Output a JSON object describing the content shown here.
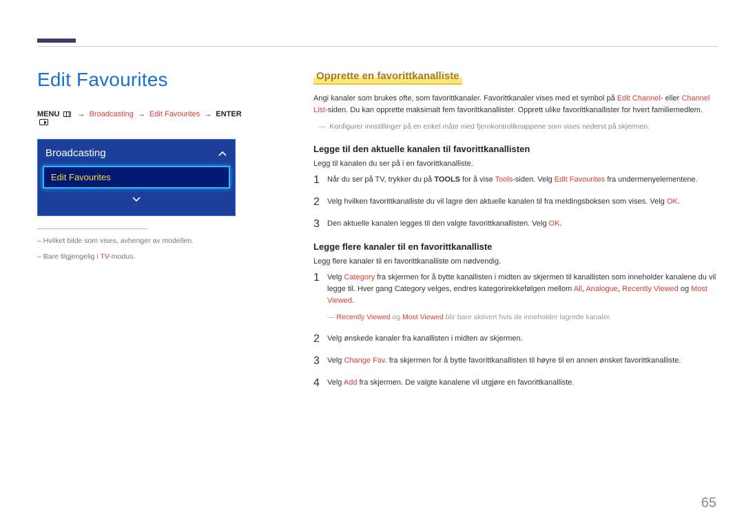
{
  "left": {
    "page_title": "Edit Favourites",
    "menu_path": {
      "menu": "MENU",
      "p1": "Broadcasting",
      "p2": "Edit Favourites",
      "enter": "ENTER"
    },
    "bc_panel": {
      "header": "Broadcasting",
      "item": "Edit Favourites"
    },
    "notes": {
      "n1": "Hvilket bilde som vises, avhenger av modellen.",
      "n2_pre": "Bare tilgjengelig i ",
      "n2_hl": "TV",
      "n2_post": "-modus."
    }
  },
  "right": {
    "section_title": "Opprette en favorittkanalliste",
    "intro": {
      "t1": "Angi kanaler som brukes ofte, som favorittkanaler. Favorittkanaler vises med et symbol på ",
      "hl1": "Edit Channel",
      "t2": "- eller ",
      "hl2": "Channel List",
      "t3": "-siden. Du kan opprette maksimalt fem favorittkanallister. Opprett ulike favorittkanallister for hvert familiemedlem."
    },
    "intro_note": "Konfigurer innstillinger på en enkel måte med fjernkontrollknappene som vises nederst på skjermen.",
    "sub1": {
      "heading": "Legge til den aktuelle kanalen til favorittkanallisten",
      "lead": "Legg til kanalen du ser på i en favorittkanalliste.",
      "steps": [
        {
          "num": "1",
          "parts": [
            {
              "t": "Når du ser på TV, trykker du på "
            },
            {
              "b": "TOOLS"
            },
            {
              "t": " for å vise "
            },
            {
              "hl": "Tools"
            },
            {
              "t": "-siden. Velg "
            },
            {
              "hl": "Edit Favourites"
            },
            {
              "t": " fra undermenyelementene."
            }
          ]
        },
        {
          "num": "2",
          "parts": [
            {
              "t": "Velg hvilken favorittkanalliste du vil lagre den aktuelle kanalen til fra meldingsboksen som vises. Velg "
            },
            {
              "hl": "OK"
            },
            {
              "t": "."
            }
          ]
        },
        {
          "num": "3",
          "parts": [
            {
              "t": "Den aktuelle kanalen legges til den valgte favorittkanallisten. Velg "
            },
            {
              "hl": "OK"
            },
            {
              "t": "."
            }
          ]
        }
      ]
    },
    "sub2": {
      "heading": "Legge flere kanaler til en favorittkanalliste",
      "lead": "Legg flere kanaler til en favorittkanalliste om nødvendig.",
      "steps": [
        {
          "num": "1",
          "parts": [
            {
              "t": "Velg "
            },
            {
              "hl": "Category"
            },
            {
              "t": " fra skjermen for å bytte kanallisten i midten av skjermen til kanallisten som inneholder kanalene du vil legge til. Hver gang Category velges, endres kategorirekkefølgen mellom "
            },
            {
              "hl": "All"
            },
            {
              "t": ", "
            },
            {
              "hl": "Analogue"
            },
            {
              "t": ", "
            },
            {
              "hl": "Recently Viewed"
            },
            {
              "t": " og "
            },
            {
              "hl": "Most Viewed"
            },
            {
              "t": "."
            }
          ],
          "note": [
            {
              "hl": "Recently Viewed"
            },
            {
              "t": " og "
            },
            {
              "hl": "Most Viewed"
            },
            {
              "t": " blir bare aktivert hvis de inneholder lagrede kanaler."
            }
          ]
        },
        {
          "num": "2",
          "parts": [
            {
              "t": "Velg ønskede kanaler fra kanallisten i midten av skjermen."
            }
          ]
        },
        {
          "num": "3",
          "parts": [
            {
              "t": "Velg "
            },
            {
              "hl": "Change Fav."
            },
            {
              "t": " fra skjermen for å bytte favorittkanallisten til høyre til en annen ønsket favorittkanalliste."
            }
          ]
        },
        {
          "num": "4",
          "parts": [
            {
              "t": "Velg "
            },
            {
              "hl": "Add"
            },
            {
              "t": " fra skjermen. De valgte kanalene vil utgjøre en favorittkanalliste."
            }
          ]
        }
      ]
    }
  },
  "page_number": "65"
}
